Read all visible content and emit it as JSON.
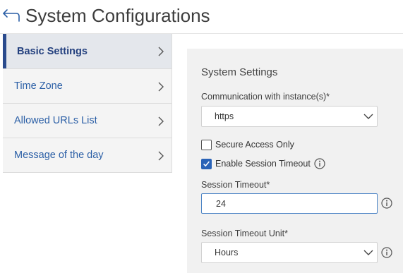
{
  "header": {
    "back_icon": "arrow-left-icon",
    "title": "System Configurations"
  },
  "sidebar": {
    "items": [
      {
        "label": "Basic Settings",
        "active": true,
        "icon": "chevron-right-icon"
      },
      {
        "label": "Time Zone",
        "active": false,
        "icon": "chevron-right-icon"
      },
      {
        "label": "Allowed URLs List",
        "active": false,
        "icon": "chevron-right-icon"
      },
      {
        "label": "Message of the day",
        "active": false,
        "icon": "chevron-right-icon"
      }
    ]
  },
  "panel": {
    "title": "System Settings",
    "communication": {
      "label": "Communication with instance(s)*",
      "value": "https"
    },
    "secure_access": {
      "label": "Secure Access Only",
      "checked": false
    },
    "enable_session_timeout": {
      "label": "Enable Session Timeout",
      "checked": true,
      "icon": "info-icon"
    },
    "session_timeout": {
      "label": "Session Timeout*",
      "value": "24",
      "icon": "info-icon"
    },
    "session_timeout_unit": {
      "label": "Session Timeout Unit*",
      "value": "Hours",
      "icon": "info-icon"
    }
  },
  "colors": {
    "accent": "#2a4b8d",
    "link": "#2b5fa6",
    "checkbox_checked": "#2a63b7",
    "input_focus_border": "#4f86c6",
    "sidebar_active_bg": "#e4e7ec",
    "sidebar_bg": "#f4f4f4",
    "panel_bg": "#f1f1f1"
  }
}
